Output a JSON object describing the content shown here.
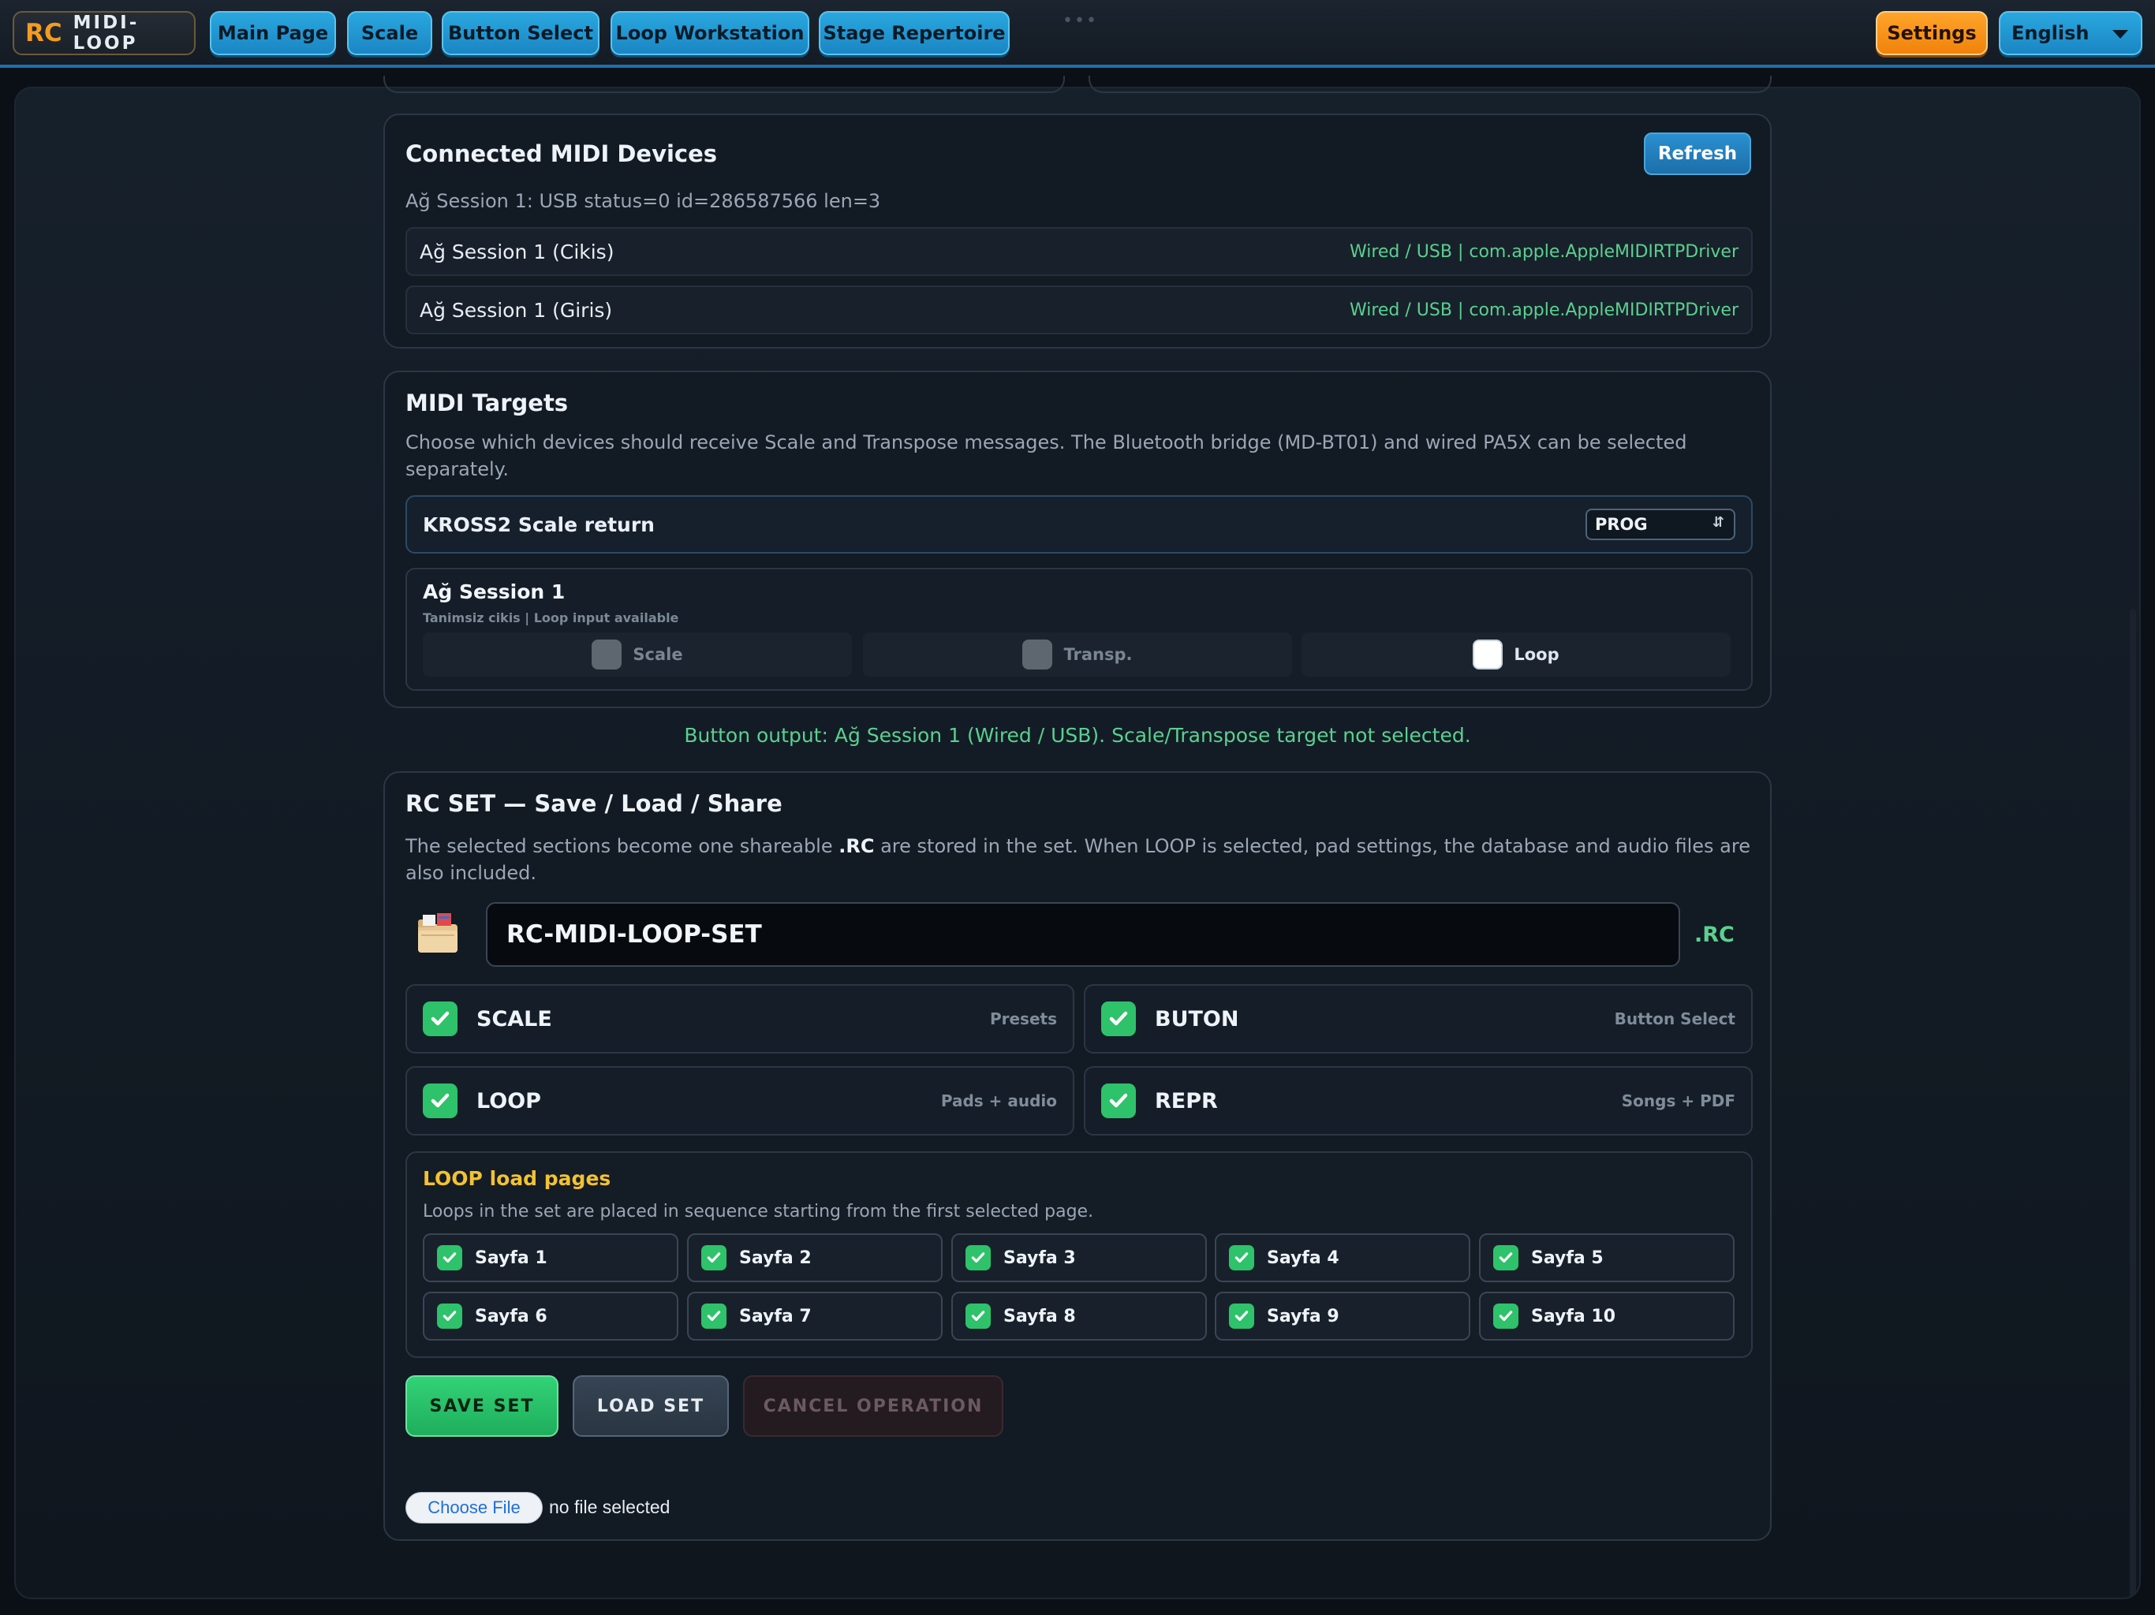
{
  "brand": {
    "rc": "RC",
    "name": "MIDI-LOOP"
  },
  "nav": {
    "items": [
      "Main Page",
      "Scale",
      "Button Select",
      "Loop Workstation",
      "Stage Repertoire"
    ],
    "grip": "•••",
    "settings": "Settings",
    "language": "English"
  },
  "devices": {
    "title": "Connected MIDI Devices",
    "refresh": "Refresh",
    "status": "Ağ Session 1: USB status=0 id=286587566 len=3",
    "list": [
      {
        "name": "Ağ Session 1 (Cikis)",
        "meta": "Wired / USB | com.apple.AppleMIDIRTPDriver"
      },
      {
        "name": "Ağ Session 1 (Giris)",
        "meta": "Wired / USB | com.apple.AppleMIDIRTPDriver"
      }
    ]
  },
  "targets": {
    "title": "MIDI Targets",
    "desc": "Choose which devices should receive Scale and Transpose messages. The Bluetooth bridge (MD-BT01) and wired PA5X can be selected separately.",
    "kross_label": "KROSS2 Scale return",
    "kross_value": "PROG",
    "session_title": "Ağ Session 1",
    "session_sub": "Tanimsiz cikis | Loop input available",
    "options": [
      {
        "label": "Scale",
        "checked": false
      },
      {
        "label": "Transp.",
        "checked": false
      },
      {
        "label": "Loop",
        "checked": true
      }
    ]
  },
  "status_line": "Button output: Ağ Session 1 (Wired / USB). Scale/Transpose target not selected.",
  "rcset": {
    "title": "RC SET — Save / Load / Share",
    "desc_a": "The selected sections become one shareable ",
    "desc_b": ".RC",
    "desc_c": " are stored in the set. When LOOP is selected, pad settings, the database and audio files are also included.",
    "filename": "RC-MIDI-LOOP-SET",
    "ext": ".RC",
    "sections": [
      {
        "label": "SCALE",
        "hint": "Presets"
      },
      {
        "label": "BUTON",
        "hint": "Button Select"
      },
      {
        "label": "LOOP",
        "hint": "Pads + audio"
      },
      {
        "label": "REPR",
        "hint": "Songs + PDF"
      }
    ],
    "pages_title": "LOOP load pages",
    "pages_desc": "Loops in the set are placed in sequence starting from the first selected page.",
    "pages": [
      "Sayfa 1",
      "Sayfa 2",
      "Sayfa 3",
      "Sayfa 4",
      "Sayfa 5",
      "Sayfa 6",
      "Sayfa 7",
      "Sayfa 8",
      "Sayfa 9",
      "Sayfa 10"
    ],
    "save": "SAVE SET",
    "load": "LOAD SET",
    "cancel": "CANCEL OPERATION",
    "file_button": "Choose File",
    "file_status": "no file selected"
  },
  "colors": {
    "accent": "#1a86c4",
    "success": "#2ec26a",
    "warning": "#f2c233",
    "orange": "#f39c1f"
  },
  "icons": {
    "folder": "folder-icon",
    "check": "check-icon",
    "caret": "chevron-down-icon"
  }
}
